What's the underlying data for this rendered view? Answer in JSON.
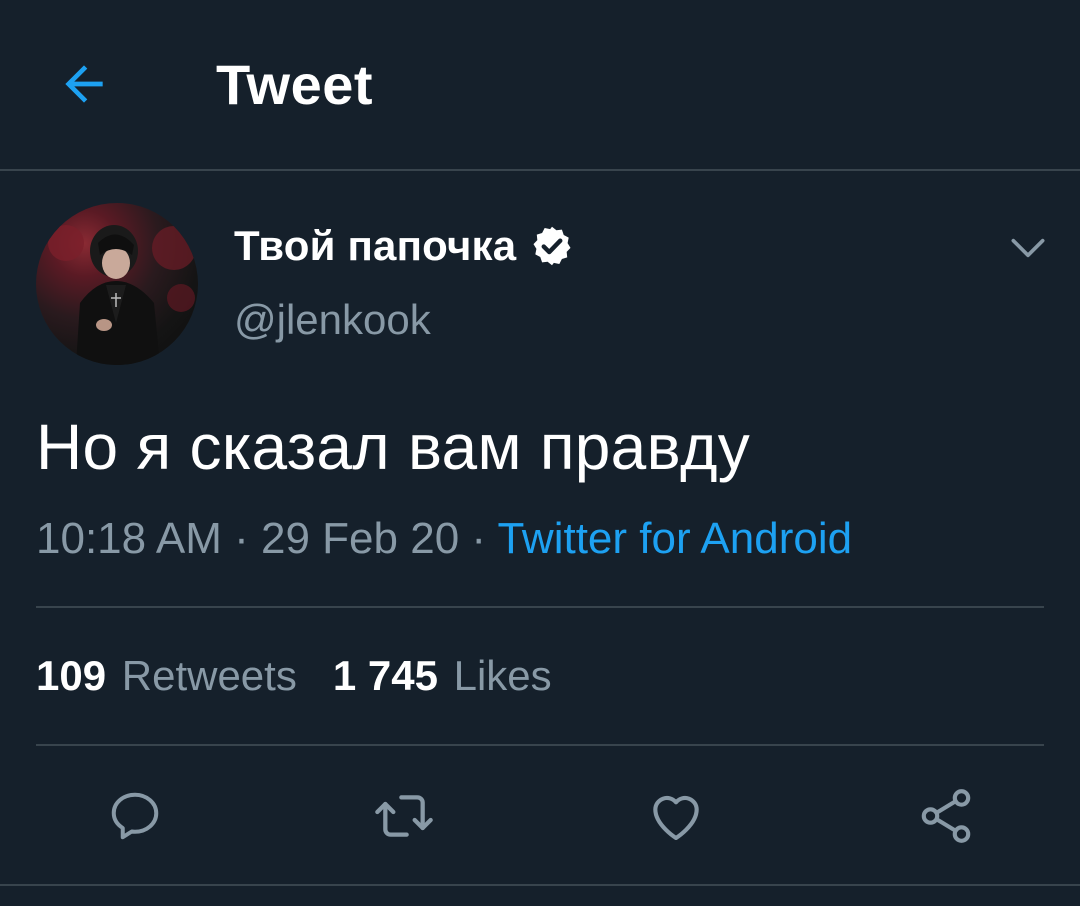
{
  "header": {
    "title": "Tweet",
    "back_icon": "arrow-left-icon"
  },
  "colors": {
    "background": "#15202b",
    "accent": "#1da1f2",
    "secondary_text": "#8899a6",
    "divider": "#38444d"
  },
  "tweet": {
    "display_name": "Твой папочка",
    "verified": true,
    "handle": "@jlenkook",
    "text": "Но я сказал вам правду",
    "time": "10:18 AM",
    "separator": " · ",
    "date": "29 Feb 20",
    "source": "Twitter for Android"
  },
  "stats": {
    "retweets_count": "109",
    "retweets_label": "Retweets",
    "likes_count": "1 745",
    "likes_label": "Likes"
  },
  "actions": [
    {
      "name": "reply",
      "icon": "reply-icon"
    },
    {
      "name": "retweet",
      "icon": "retweet-icon"
    },
    {
      "name": "like",
      "icon": "heart-icon"
    },
    {
      "name": "share",
      "icon": "share-icon"
    }
  ]
}
